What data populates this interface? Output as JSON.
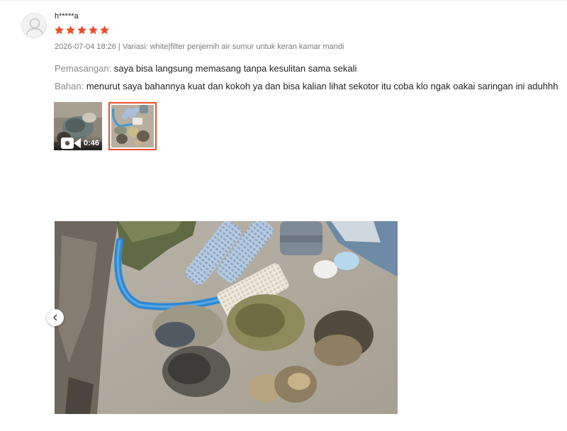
{
  "review": {
    "username": "h*****a",
    "rating": 5,
    "rating_color": "#ee4d2d",
    "meta": "2026-07-04 18:26 | Variasi: white|filter penjernih air sumur untuk keran kamar mandi",
    "attributes": [
      {
        "key": "Pemasangan:",
        "value": "saya bisa langsung memasang tanpa kesulitan sama sekali"
      },
      {
        "key": "Bahan:",
        "value": "menurut saya bahannya kuat dan kokoh ya dan bisa kalian lihat sekotor itu coba klo ngak oakai saringan ini aduhhh"
      }
    ],
    "media": [
      {
        "type": "video",
        "duration": "0:46",
        "icon": "video-camera-icon"
      },
      {
        "type": "image",
        "selected": true
      }
    ]
  },
  "icons": {
    "avatar": "user-avatar-icon",
    "star": "star-icon",
    "prev": "chevron-left-icon"
  }
}
